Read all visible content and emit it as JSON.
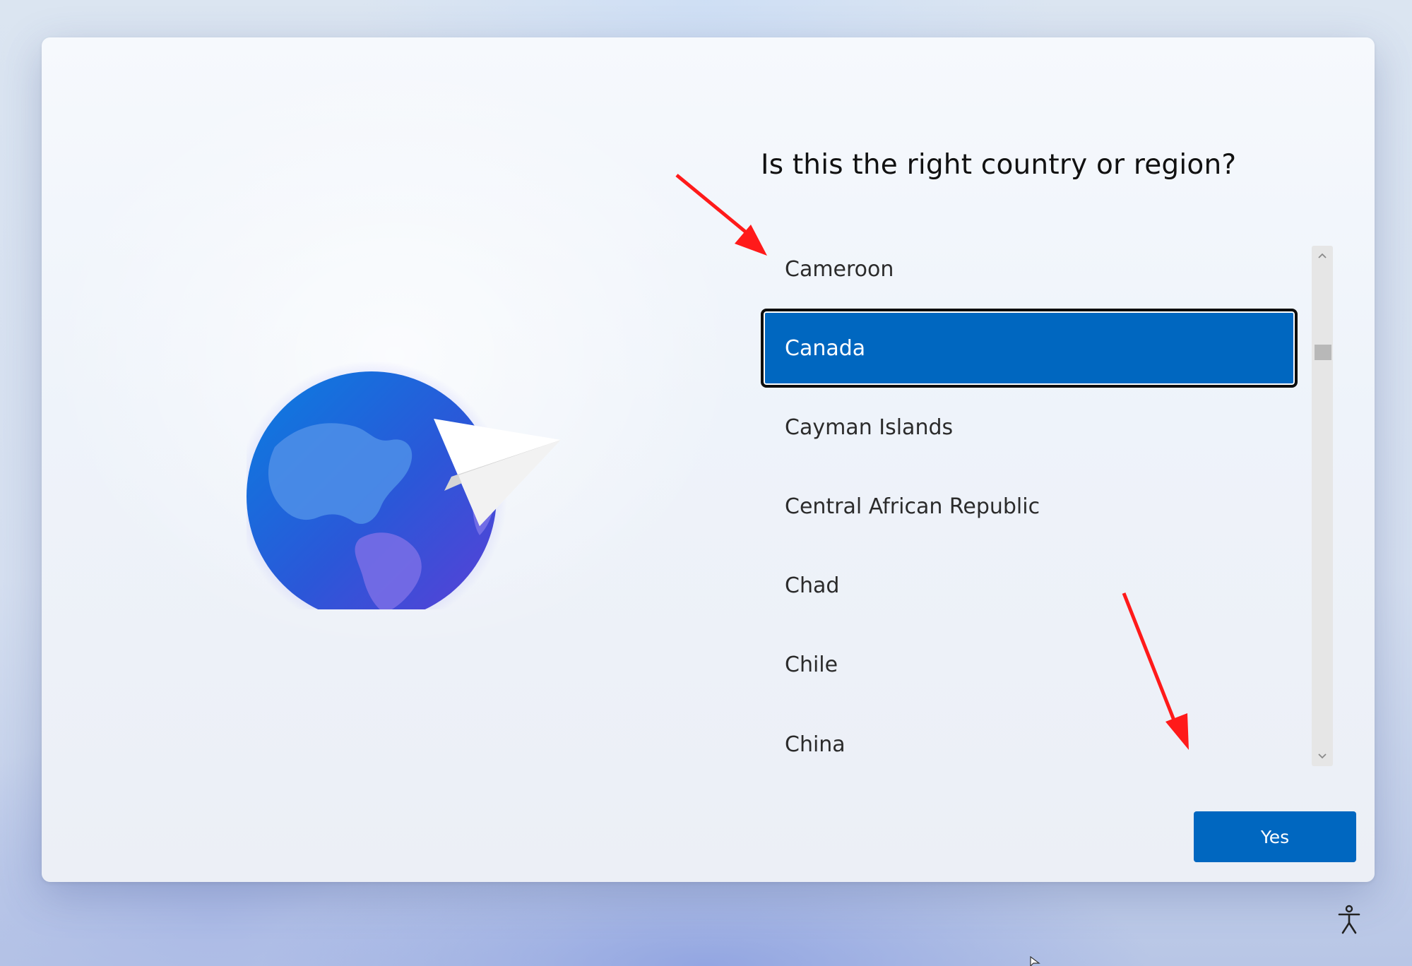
{
  "heading": "Is this the right country or region?",
  "countries": [
    {
      "label": "Cameroon",
      "selected": false
    },
    {
      "label": "Canada",
      "selected": true
    },
    {
      "label": "Cayman Islands",
      "selected": false
    },
    {
      "label": "Central African Republic",
      "selected": false
    },
    {
      "label": "Chad",
      "selected": false
    },
    {
      "label": "Chile",
      "selected": false
    },
    {
      "label": "China",
      "selected": false
    }
  ],
  "yes_button_label": "Yes",
  "colors": {
    "accent": "#0067c0",
    "annotation_arrow": "#ff1a1a"
  },
  "icons": {
    "illustration": "globe-paper-plane-icon",
    "accessibility": "accessibility-icon",
    "scroll_up": "chevron-up-icon",
    "scroll_down": "chevron-down-icon"
  }
}
